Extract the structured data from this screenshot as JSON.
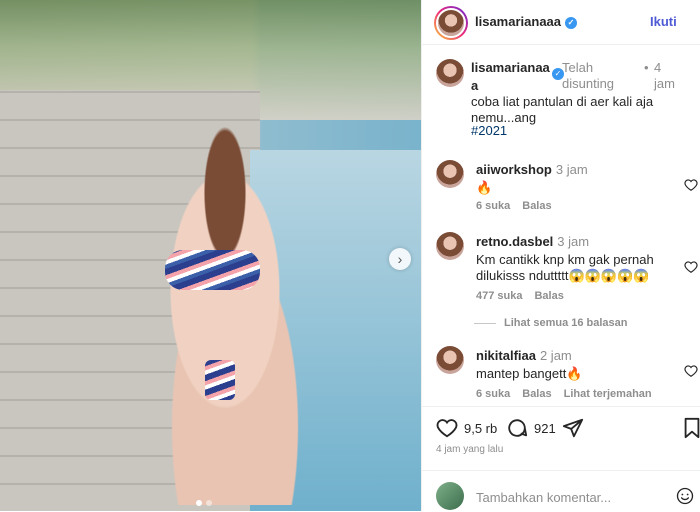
{
  "post": {
    "username": "lisamarianaaa",
    "follow_label": "Ikuti",
    "caption_name_line1": "lisamarianaa",
    "caption_name_line2": "a",
    "edited_label": "Telah disunting",
    "time": "4 jam",
    "caption_text": "coba liat pantulan di aer kali aja nemu...ang",
    "hashtag": "#2021"
  },
  "comments": [
    {
      "user": "aiiworkshop",
      "time": "3 jam",
      "text": "🔥",
      "likes": "6 suka",
      "reply": "Balas"
    },
    {
      "user": "retno.dasbel",
      "time": "3 jam",
      "text": "Km cantikk knp km gak pernah dilukisss nduttttt😱😱😱😱😱",
      "likes": "477 suka",
      "reply": "Balas"
    },
    {
      "user": "nikitalfiaa",
      "time": "2 jam",
      "text": "mantep bangett🔥",
      "likes": "6 suka",
      "reply": "Balas",
      "translate": "Lihat terjemahan"
    }
  ],
  "view_replies": "Lihat semua 16 balasan",
  "actions": {
    "likes": "9,5 rb",
    "comments": "921"
  },
  "post_age": "4 jam yang lalu",
  "add_comment_placeholder": "Tambahkan komentar...",
  "colors": {
    "verified": "#3897f0",
    "follow": "#4f5bd5",
    "hashtag": "#00376b"
  }
}
